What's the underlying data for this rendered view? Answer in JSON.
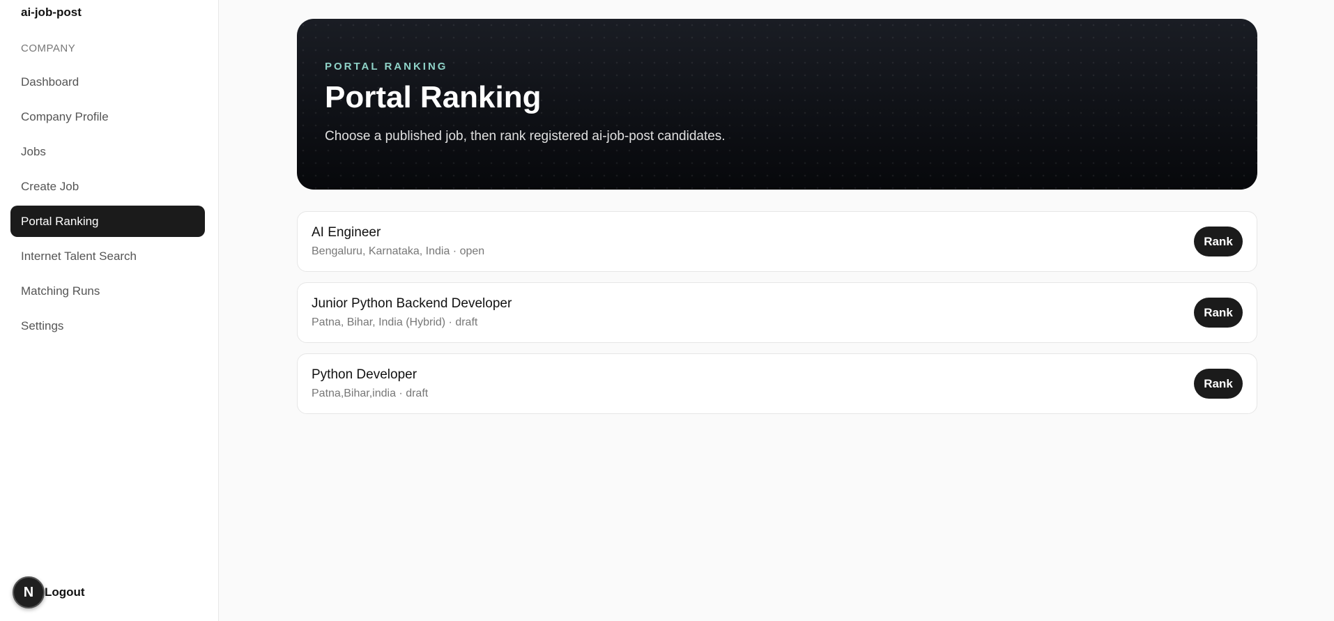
{
  "sidebar": {
    "brand": "ai-job-post",
    "section_label": "COMPANY",
    "items": [
      {
        "label": "Dashboard",
        "active": false
      },
      {
        "label": "Company Profile",
        "active": false
      },
      {
        "label": "Jobs",
        "active": false
      },
      {
        "label": "Create Job",
        "active": false
      },
      {
        "label": "Portal Ranking",
        "active": true
      },
      {
        "label": "Internet Talent Search",
        "active": false
      },
      {
        "label": "Matching Runs",
        "active": false
      },
      {
        "label": "Settings",
        "active": false
      }
    ],
    "avatar_letter": "N",
    "logout_label": "Logout"
  },
  "hero": {
    "eyebrow": "PORTAL RANKING",
    "title": "Portal Ranking",
    "subtitle": "Choose a published job, then rank registered ai-job-post candidates."
  },
  "jobs": [
    {
      "title": "AI Engineer",
      "meta": "Bengaluru, Karnataka, India · open",
      "button": "Rank"
    },
    {
      "title": "Junior Python Backend Developer",
      "meta": "Patna, Bihar, India (Hybrid) · draft",
      "button": "Rank"
    },
    {
      "title": "Python Developer",
      "meta": "Patna,Bihar,india · draft",
      "button": "Rank"
    }
  ],
  "colors": {
    "accent_dark": "#1b1b1b",
    "eyebrow": "#8fd3c8",
    "background": "#fafafa"
  }
}
